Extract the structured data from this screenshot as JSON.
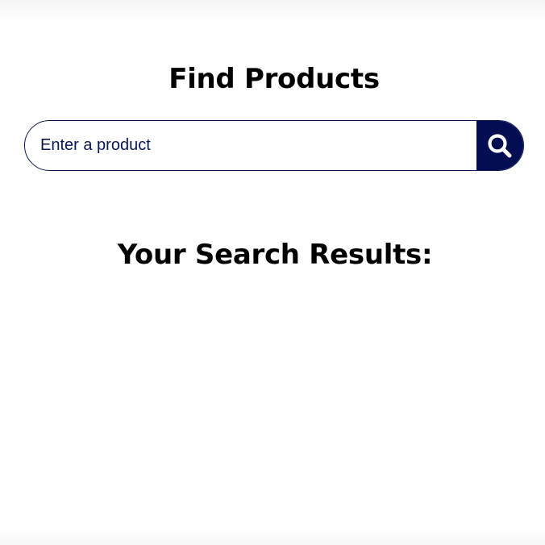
{
  "header": {
    "title": "Find Products"
  },
  "search": {
    "placeholder": "Enter a product",
    "value": "",
    "button_icon": "search-icon"
  },
  "results": {
    "heading": "Your Search Results:",
    "items": []
  },
  "colors": {
    "accent": "#020d52",
    "border": "#0a1650",
    "background": "#ffffff",
    "text": "#000000"
  }
}
